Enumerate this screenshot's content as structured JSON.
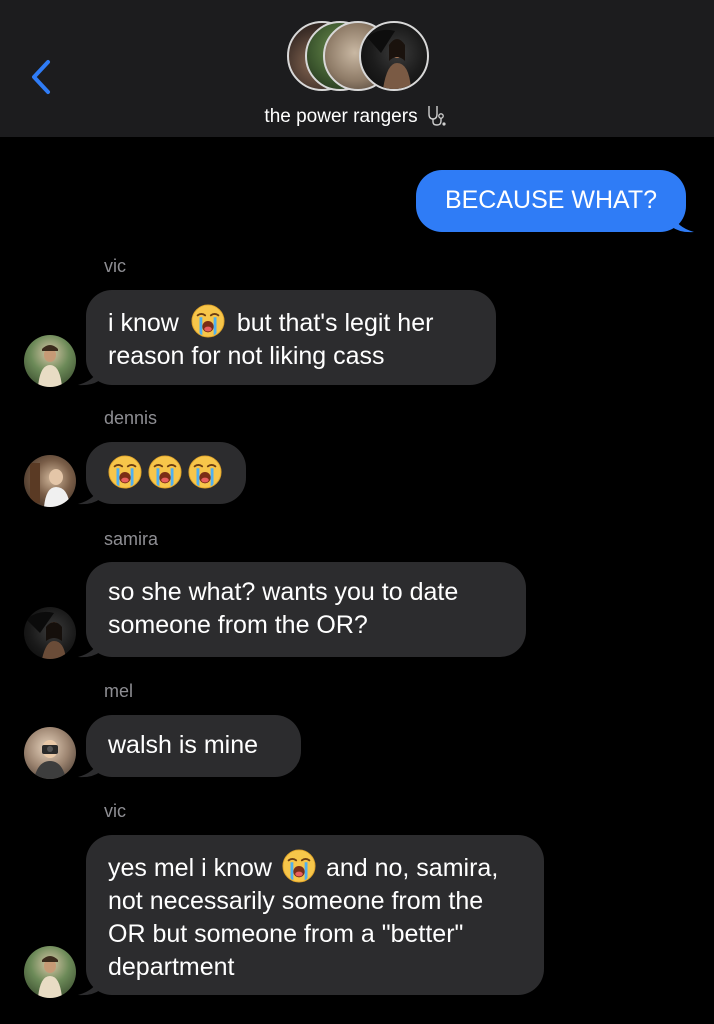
{
  "header": {
    "title": "the power rangers",
    "back_icon": "chevron-left-icon",
    "title_icon": "stethoscope-icon",
    "accent_color": "#2f7cf6"
  },
  "messages": [
    {
      "type": "outgoing",
      "text": "BECAUSE WHAT?"
    },
    {
      "type": "incoming",
      "sender": "vic",
      "text_a": "i know",
      "text_b": "but that's legit her reason for not liking cass",
      "emoji": "loudly-crying-face-icon"
    },
    {
      "type": "incoming",
      "sender": "dennis",
      "emoji_count": 3,
      "emoji": "loudly-crying-face-icon"
    },
    {
      "type": "incoming",
      "sender": "samira",
      "text": "so she what? wants you to date someone from the OR?"
    },
    {
      "type": "incoming",
      "sender": "mel",
      "text": "walsh is mine"
    },
    {
      "type": "incoming",
      "sender": "vic",
      "text_a": "yes mel i know",
      "text_b": "and no, samira, not necessarily someone from the OR but someone from a \"better\" department",
      "emoji": "loudly-crying-face-icon"
    }
  ]
}
